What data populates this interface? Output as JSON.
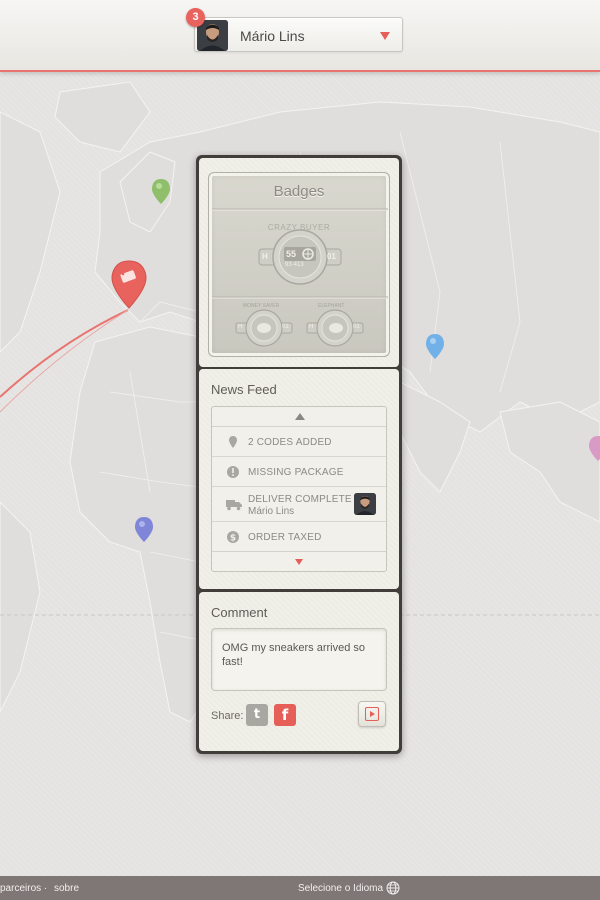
{
  "header": {
    "notification_count": "3",
    "user_name": "Mário Lins"
  },
  "badges": {
    "title": "Badges",
    "main_badge": {
      "name": "CRAZY BUYER",
      "left_tag": "H",
      "right_tag": "01",
      "code": "55",
      "sub_code": "93·413"
    },
    "small_badges": [
      {
        "name": "MONEY SAVER",
        "left_tag": "H",
        "right_tag": "01"
      },
      {
        "name": "ELEPHANT",
        "left_tag": "H",
        "right_tag": "01"
      }
    ]
  },
  "news_feed": {
    "title": "News Feed",
    "items": [
      {
        "icon": "map-pin-icon",
        "text": "2 CODES ADDED",
        "sub": ""
      },
      {
        "icon": "alert-icon",
        "text": "MISSING PACKAGE",
        "sub": ""
      },
      {
        "icon": "truck-icon",
        "text": "DELIVER COMPLETE",
        "sub": "Mário Lins"
      },
      {
        "icon": "dollar-icon",
        "text": "ORDER TAXED",
        "sub": ""
      }
    ]
  },
  "comment": {
    "title": "Comment",
    "text": "OMG my sneakers arrived so fast!",
    "share_label": "Share:",
    "twitter_glyph": "t",
    "facebook_glyph": "f"
  },
  "footer": {
    "partners_link": "parceiros",
    "separator": ".",
    "about_link": "sobre",
    "language_label": "Selecione o Idioma"
  },
  "colors": {
    "accent": "#e8635d",
    "panel_frame": "#403d3b",
    "footer_bg": "#7f7775",
    "map_bg": "#e5e3e2"
  }
}
